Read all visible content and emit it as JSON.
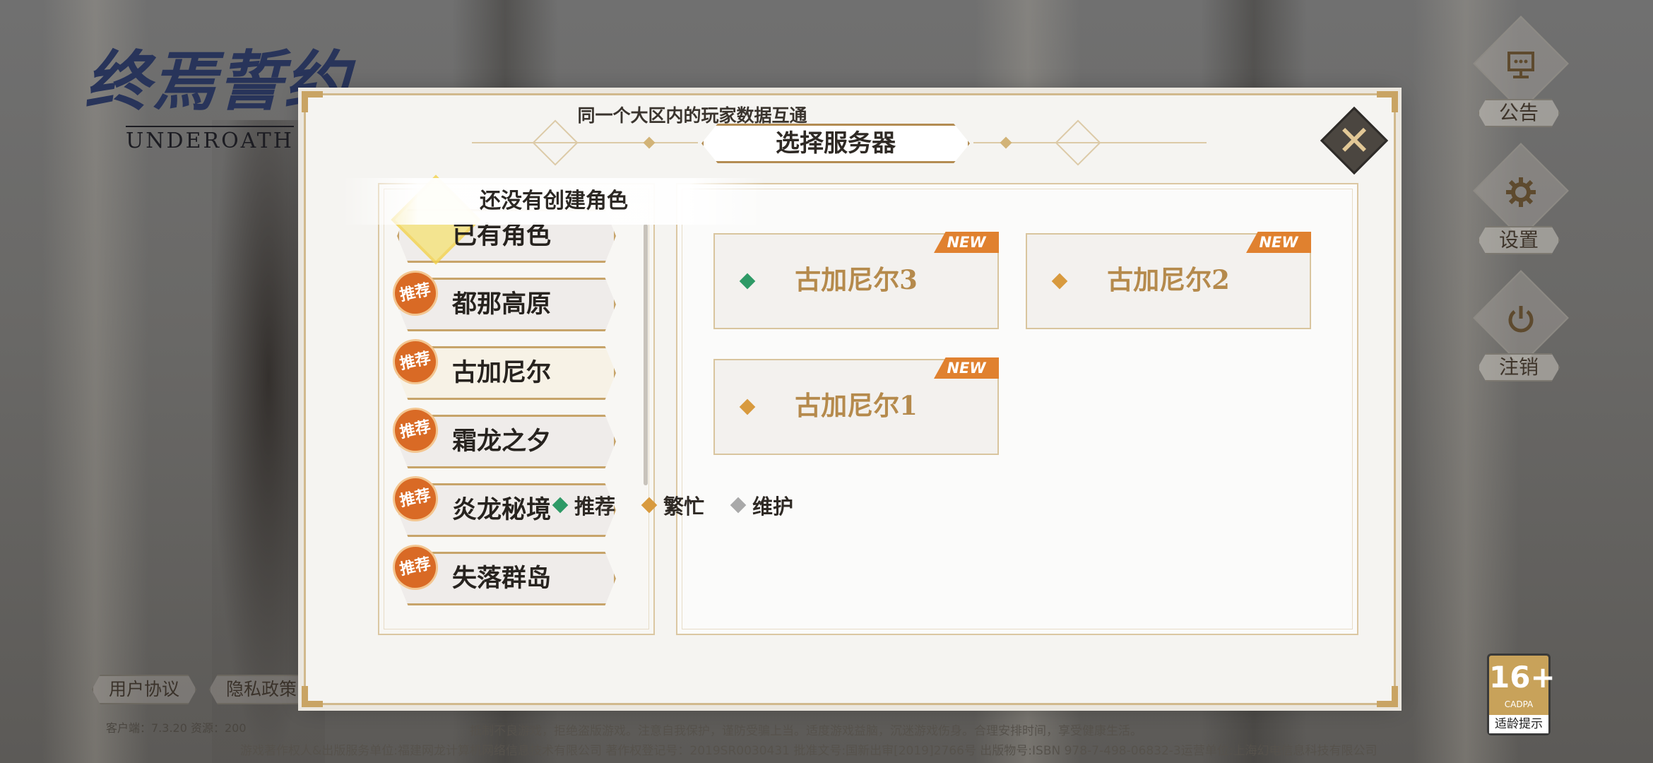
{
  "logo": {
    "cn": "终焉誓约",
    "en": "UNDEROATH"
  },
  "side_menu": [
    {
      "label": "公告",
      "icon": "notice-icon"
    },
    {
      "label": "设置",
      "icon": "gear-icon"
    },
    {
      "label": "注销",
      "icon": "power-icon"
    }
  ],
  "dialog": {
    "title": "选择服务器",
    "hint": "同一个大区内的玩家数据互通",
    "toast": "还没有创建角色",
    "regions": [
      {
        "label": "已有角色",
        "recommended": false
      },
      {
        "label": "都那高原",
        "recommended": true,
        "badge": "推荐"
      },
      {
        "label": "古加尼尔",
        "recommended": true,
        "badge": "推荐",
        "active": true
      },
      {
        "label": "霜龙之夕",
        "recommended": true,
        "badge": "推荐"
      },
      {
        "label": "炎龙秘境",
        "recommended": true,
        "badge": "推荐"
      },
      {
        "label": "失落群岛",
        "recommended": true,
        "badge": "推荐"
      }
    ],
    "servers": [
      {
        "name": "古加尼尔3",
        "status": "recommended",
        "badge": "NEW"
      },
      {
        "name": "古加尼尔2",
        "status": "busy",
        "badge": "NEW"
      },
      {
        "name": "古加尼尔1",
        "status": "busy",
        "badge": "NEW"
      }
    ],
    "legend": [
      {
        "label": "推荐",
        "color": "#2e9a66"
      },
      {
        "label": "繁忙",
        "color": "#d89a3e"
      },
      {
        "label": "维护",
        "color": "#a9a9a9"
      }
    ]
  },
  "bottom": {
    "user_agreement": "用户协议",
    "privacy_policy": "隐私政策",
    "version": "客户端：7.3.20  资源：200",
    "legal_line1": "抵制不良游戏，拒绝盗版游戏。注意自我保护，谨防受骗上当。适度游戏益脑，沉迷游戏伤身。合理安排时间，享受健康生活。",
    "legal_line2": "游戏著作权人&出版服务单位:福建网龙计算机网络信息技术有限公司  著作权登记号：2019SR0030431  批准文号:国新出审[2019]2766号  出版物号:ISBN 978-7-498-06832-3运营单位:上海幻电信息科技有限公司"
  },
  "age_badge": {
    "rating": "16+",
    "cadpa": "CADPA",
    "tip": "适龄提示"
  }
}
